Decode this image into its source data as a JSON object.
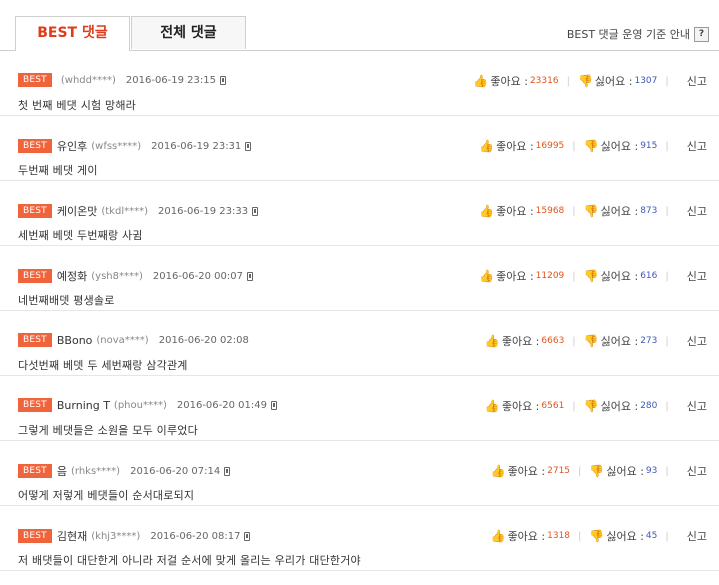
{
  "tabs": [
    {
      "label": "BEST 댓글"
    },
    {
      "label": "전체 댓글"
    }
  ],
  "policy": {
    "label": "BEST 댓글 운영 기준 안내",
    "help": "?"
  },
  "badge": "BEST",
  "labels": {
    "like": "좋아요 :",
    "dislike": "싫어요 :",
    "report": "신고"
  },
  "colors": {
    "active_tab": "#e03c1c",
    "badge": "#f0643c",
    "like_count": "#e2551e",
    "dislike_count": "#3e5ab8"
  },
  "comments": [
    {
      "nick": "",
      "uid": "(whdd****)",
      "date": "2016-06-19 23:15",
      "text": "첫 번째 베댓 시험 망해라",
      "likes": "23316",
      "dislikes": "1307"
    },
    {
      "nick": "유인후",
      "uid": "(wfss****)",
      "date": "2016-06-19 23:31",
      "text": "두번째 베댓 게이",
      "likes": "16995",
      "dislikes": "915"
    },
    {
      "nick": "케이온맛",
      "uid": "(tkdl****)",
      "date": "2016-06-19 23:33",
      "text": "세번째 베뎃 두번째랑 사귐",
      "likes": "15968",
      "dislikes": "873"
    },
    {
      "nick": "예정화",
      "uid": "(ysh8****)",
      "date": "2016-06-20 00:07",
      "text": "네번째배뎃 평생솔로",
      "likes": "11209",
      "dislikes": "616"
    },
    {
      "nick": "BBono",
      "uid": "(nova****)",
      "date": "2016-06-20 02:08",
      "text": "다섯번째 베뎃 두 세번째랑 삼각관계",
      "likes": "6663",
      "dislikes": "273"
    },
    {
      "nick": "Burning T",
      "uid": "(phou****)",
      "date": "2016-06-20 01:49",
      "text": "그렇게 베댓들은 소원을 모두 이루었다",
      "likes": "6561",
      "dislikes": "280"
    },
    {
      "nick": "음",
      "uid": "(rhks****)",
      "date": "2016-06-20 07:14",
      "text": "어떻게 저렇게 베댓들이 순서대로되지",
      "likes": "2715",
      "dislikes": "93"
    },
    {
      "nick": "김현재",
      "uid": "(khj3****)",
      "date": "2016-06-20 08:17",
      "text": "저 배댓들이 대단한게 아니라 저걸 순서에 맞게 올리는 우리가 대단한거야",
      "likes": "1318",
      "dislikes": "45"
    }
  ]
}
